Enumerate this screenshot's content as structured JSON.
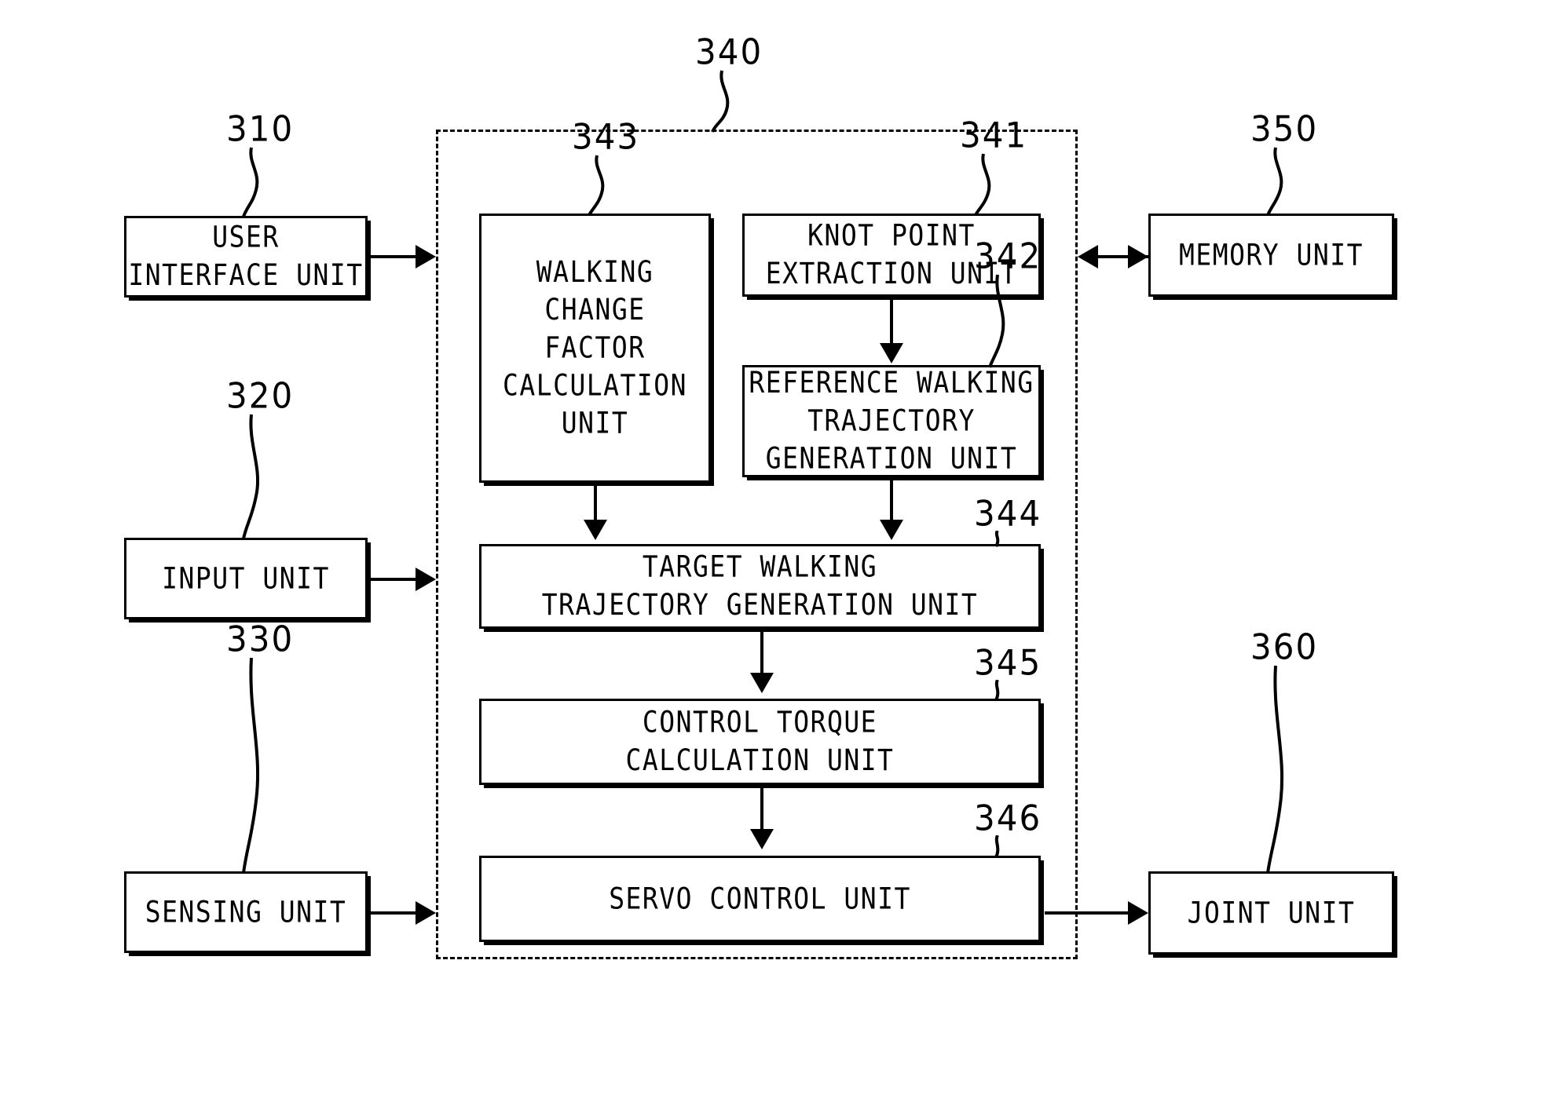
{
  "figure": {
    "type": "patent-block-diagram",
    "background_color": "#ffffff",
    "line_color": "#000000"
  },
  "controller": {
    "ref": "340",
    "style": "dashed-boundary"
  },
  "external_blocks": [
    {
      "ref": "310",
      "label": "USER\nINTERFACE UNIT"
    },
    {
      "ref": "320",
      "label": "INPUT UNIT"
    },
    {
      "ref": "330",
      "label": "SENSING UNIT"
    },
    {
      "ref": "350",
      "label": "MEMORY UNIT"
    },
    {
      "ref": "360",
      "label": "JOINT UNIT"
    }
  ],
  "internal_blocks": [
    {
      "ref": "343",
      "label": "WALKING\nCHANGE\nFACTOR\nCALCULATION\nUNIT"
    },
    {
      "ref": "341",
      "label": "KNOT POINT\nEXTRACTION UNIT"
    },
    {
      "ref": "342",
      "label": "REFERENCE WALKING\nTRAJECTORY\nGENERATION UNIT"
    },
    {
      "ref": "344",
      "label": "TARGET WALKING\nTRAJECTORY GENERATION UNIT"
    },
    {
      "ref": "345",
      "label": "CONTROL TORQUE\nCALCULATION UNIT"
    },
    {
      "ref": "346",
      "label": "SERVO CONTROL UNIT"
    }
  ],
  "blocks": {
    "user_interface_unit": {
      "ref": "310",
      "label": "USER\nINTERFACE UNIT"
    },
    "input_unit": {
      "ref": "320",
      "label": "INPUT UNIT"
    },
    "sensing_unit": {
      "ref": "330",
      "label": "SENSING UNIT"
    },
    "memory_unit": {
      "ref": "350",
      "label": "MEMORY UNIT"
    },
    "joint_unit": {
      "ref": "360",
      "label": "JOINT UNIT"
    },
    "control_unit": {
      "ref": "340",
      "label": ""
    },
    "walking_change_factor": {
      "ref": "343",
      "label": "WALKING\nCHANGE\nFACTOR\nCALCULATION\nUNIT"
    },
    "knot_point_extraction": {
      "ref": "341",
      "label": "KNOT POINT\nEXTRACTION UNIT"
    },
    "reference_walking_trajectory": {
      "ref": "342",
      "label": "REFERENCE WALKING\nTRAJECTORY\nGENERATION UNIT"
    },
    "target_walking_trajectory": {
      "ref": "344",
      "label": "TARGET WALKING\nTRAJECTORY GENERATION UNIT"
    },
    "control_torque_calculation": {
      "ref": "345",
      "label": "CONTROL TORQUE\nCALCULATION UNIT"
    },
    "servo_control_unit": {
      "ref": "346",
      "label": "SERVO CONTROL UNIT"
    }
  },
  "connections": [
    {
      "from": "user_interface_unit",
      "to": "control_unit",
      "kind": "arrow-right"
    },
    {
      "from": "input_unit",
      "to": "control_unit",
      "kind": "arrow-right"
    },
    {
      "from": "sensing_unit",
      "to": "control_unit",
      "kind": "arrow-right"
    },
    {
      "from": "control_unit",
      "to": "memory_unit",
      "kind": "arrow-bidirectional"
    },
    {
      "from": "servo_control_unit",
      "to": "joint_unit",
      "kind": "arrow-right"
    },
    {
      "from": "knot_point_extraction",
      "to": "reference_walking_trajectory",
      "kind": "arrow-down"
    },
    {
      "from": "walking_change_factor",
      "to": "target_walking_trajectory",
      "kind": "arrow-down"
    },
    {
      "from": "reference_walking_trajectory",
      "to": "target_walking_trajectory",
      "kind": "arrow-down"
    },
    {
      "from": "target_walking_trajectory",
      "to": "control_torque_calculation",
      "kind": "arrow-down"
    },
    {
      "from": "control_torque_calculation",
      "to": "servo_control_unit",
      "kind": "arrow-down"
    }
  ]
}
